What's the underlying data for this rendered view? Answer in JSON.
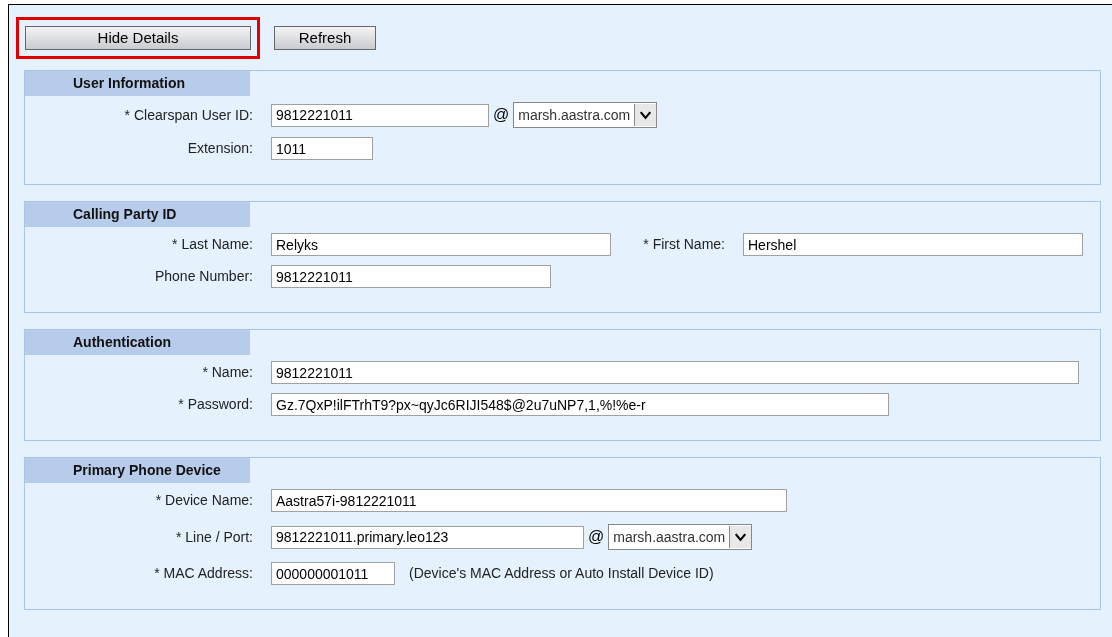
{
  "toolbar": {
    "buttons": [
      {
        "label": "Hide Details",
        "highlighted": true
      },
      {
        "label": "Refresh",
        "highlighted": false
      }
    ]
  },
  "sections": [
    {
      "title": "User Information",
      "rows": [
        {
          "kind": "domain",
          "label": "* Clearspan User ID:",
          "value": "9812221011",
          "at": "@",
          "domain": "marsh.aastra.com"
        },
        {
          "kind": "plain",
          "label": "Extension:",
          "value": "1011"
        }
      ]
    },
    {
      "title": "Calling Party ID",
      "rows": [
        {
          "kind": "pair",
          "label": "* Last Name:",
          "value": "Relyks",
          "label2": "* First Name:",
          "value2": "Hershel"
        },
        {
          "kind": "plain",
          "label": "Phone Number:",
          "value": "9812221011"
        }
      ]
    },
    {
      "title": "Authentication",
      "rows": [
        {
          "kind": "plain",
          "label": "* Name:",
          "value": "9812221011"
        },
        {
          "kind": "plain",
          "label": "* Password:",
          "value": "Gz.7QxP!ilFTrhT9?px~qyJc6RIJI548$@2u7uNP7,1,%!%e-r"
        }
      ]
    },
    {
      "title": "Primary Phone Device",
      "rows": [
        {
          "kind": "plain",
          "label": "* Device Name:",
          "value": "Aastra57i-9812221011"
        },
        {
          "kind": "domain",
          "label": "* Line / Port:",
          "value": "9812221011.primary.leo123",
          "at": "@",
          "domain": "marsh.aastra.com"
        },
        {
          "kind": "note",
          "label": "* MAC Address:",
          "value": "000000001011",
          "note": "(Device's MAC Address or Auto Install Device ID)"
        }
      ]
    }
  ]
}
